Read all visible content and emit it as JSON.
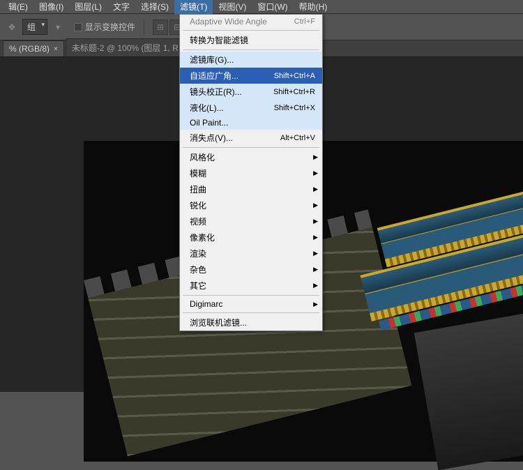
{
  "menubar": {
    "items": [
      {
        "label": "辑(E)",
        "key": "E"
      },
      {
        "label": "图像(I)",
        "key": "I"
      },
      {
        "label": "图层(L)",
        "key": "L"
      },
      {
        "label": "文字"
      },
      {
        "label": "选择(S)",
        "key": "S"
      },
      {
        "label": "滤镜(T)",
        "key": "T",
        "active": true
      },
      {
        "label": "视图(V)",
        "key": "V"
      },
      {
        "label": "窗口(W)",
        "key": "W"
      },
      {
        "label": "帮助(H)",
        "key": "H"
      }
    ]
  },
  "toolbar": {
    "group_select": "组",
    "checkbox_label": "显示变换控件"
  },
  "tabs": [
    {
      "label": "% (RGB/8)",
      "active": true
    },
    {
      "label": "未标题-2 @ 100% (图层 1, R",
      "active": false
    }
  ],
  "dropdown": {
    "items": [
      {
        "label": "Adaptive Wide Angle",
        "shortcut": "Ctrl+F",
        "disabled": true
      },
      {
        "sep": true
      },
      {
        "label": "转换为智能滤镜"
      },
      {
        "sep": true
      },
      {
        "label": "滤镜库(G)...",
        "highlight": true
      },
      {
        "label": "自适应广角...",
        "shortcut": "Shift+Ctrl+A",
        "selected": true
      },
      {
        "label": "镜头校正(R)...",
        "shortcut": "Shift+Ctrl+R",
        "highlight": true
      },
      {
        "label": "液化(L)...",
        "shortcut": "Shift+Ctrl+X",
        "highlight": true
      },
      {
        "label": "Oil Paint...",
        "highlight": true
      },
      {
        "label": "消失点(V)...",
        "shortcut": "Alt+Ctrl+V"
      },
      {
        "sep": true
      },
      {
        "label": "风格化",
        "submenu": true
      },
      {
        "label": "模糊",
        "submenu": true
      },
      {
        "label": "扭曲",
        "submenu": true
      },
      {
        "label": "锐化",
        "submenu": true
      },
      {
        "label": "视频",
        "submenu": true
      },
      {
        "label": "像素化",
        "submenu": true
      },
      {
        "label": "渲染",
        "submenu": true
      },
      {
        "label": "杂色",
        "submenu": true
      },
      {
        "label": "其它",
        "submenu": true
      },
      {
        "sep": true
      },
      {
        "label": "Digimarc",
        "submenu": true
      },
      {
        "sep": true
      },
      {
        "label": "浏览联机滤镜..."
      }
    ]
  }
}
